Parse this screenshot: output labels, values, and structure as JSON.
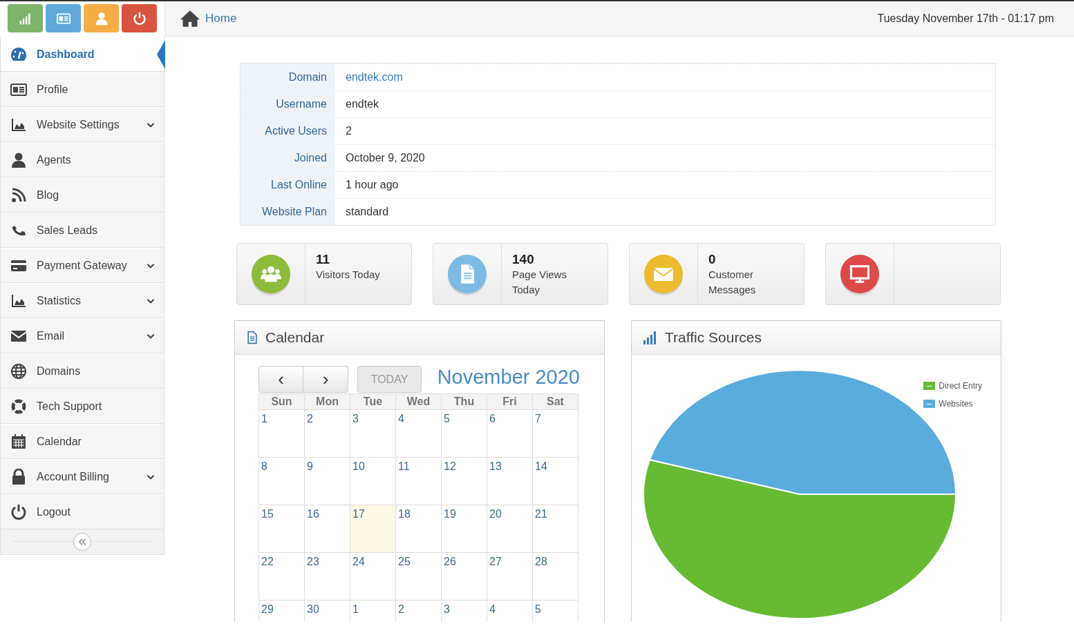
{
  "top_buttons": [
    {
      "color": "#7fb46b"
    },
    {
      "color": "#5fa9dd"
    },
    {
      "color": "#f8ac45"
    },
    {
      "color": "#d9543e"
    }
  ],
  "sidebar": {
    "items": [
      {
        "label": "Dashboard",
        "selected": true,
        "has_submenu": false
      },
      {
        "label": "Profile",
        "selected": false,
        "has_submenu": false
      },
      {
        "label": "Website Settings",
        "selected": false,
        "has_submenu": true
      },
      {
        "label": "Agents",
        "selected": false,
        "has_submenu": false
      },
      {
        "label": "Blog",
        "selected": false,
        "has_submenu": false
      },
      {
        "label": "Sales Leads",
        "selected": false,
        "has_submenu": false
      },
      {
        "label": "Payment Gateway",
        "selected": false,
        "has_submenu": true
      },
      {
        "label": "Statistics",
        "selected": false,
        "has_submenu": true
      },
      {
        "label": "Email",
        "selected": false,
        "has_submenu": true
      },
      {
        "label": "Domains",
        "selected": false,
        "has_submenu": false
      },
      {
        "label": "Tech Support",
        "selected": false,
        "has_submenu": false
      },
      {
        "label": "Calendar",
        "selected": false,
        "has_submenu": false
      },
      {
        "label": "Account Billing",
        "selected": false,
        "has_submenu": true
      },
      {
        "label": "Logout",
        "selected": false,
        "has_submenu": false
      }
    ]
  },
  "breadcrumb": {
    "label": "Home"
  },
  "datetime": "Tuesday November 17th - 01:17 pm",
  "account_info": [
    {
      "label": "Domain",
      "value": "endtek.com",
      "kind": "link"
    },
    {
      "label": "Username",
      "value": "endtek",
      "kind": "text"
    },
    {
      "label": "Active Users",
      "value": "2",
      "kind": "text"
    },
    {
      "label": "Joined",
      "value": "October 9, 2020",
      "kind": "text"
    },
    {
      "label": "Last Online",
      "value": "1 hour ago",
      "kind": "text"
    },
    {
      "label": "Website Plan",
      "value": "standard",
      "kind": "text"
    }
  ],
  "stats": [
    {
      "value": "11",
      "label": "Visitors Today",
      "color": "#8dbb3c"
    },
    {
      "value": "140",
      "label": "Page Views Today",
      "color": "#7dbbe6"
    },
    {
      "value": "0",
      "label": "Customer Messages",
      "color": "#ecbb2e"
    },
    {
      "color": "#dc4a48"
    }
  ],
  "calendar": {
    "title": "Calendar",
    "prev": "‹",
    "next": "›",
    "today_button": {
      "label": "TODAY",
      "disabled": true
    },
    "month": "November 2020",
    "weekdays": [
      "Sun",
      "Mon",
      "Tue",
      "Wed",
      "Thu",
      "Fri",
      "Sat"
    ],
    "weeks": [
      {
        "days": [
          {
            "day": "1",
            "today": false
          },
          {
            "day": "2",
            "today": false
          },
          {
            "day": "3",
            "today": false
          },
          {
            "day": "4",
            "today": false
          },
          {
            "day": "5",
            "today": false
          },
          {
            "day": "6",
            "today": false
          },
          {
            "day": "7",
            "today": false
          }
        ]
      },
      {
        "days": [
          {
            "day": "8",
            "today": false
          },
          {
            "day": "9",
            "today": false
          },
          {
            "day": "10",
            "today": false
          },
          {
            "day": "11",
            "today": false
          },
          {
            "day": "12",
            "today": false
          },
          {
            "day": "13",
            "today": false
          },
          {
            "day": "14",
            "today": false
          }
        ]
      },
      {
        "days": [
          {
            "day": "15",
            "today": false
          },
          {
            "day": "16",
            "today": false
          },
          {
            "day": "17",
            "today": true
          },
          {
            "day": "18",
            "today": false
          },
          {
            "day": "19",
            "today": false
          },
          {
            "day": "20",
            "today": false
          },
          {
            "day": "21",
            "today": false
          }
        ]
      },
      {
        "days": [
          {
            "day": "22",
            "today": false
          },
          {
            "day": "23",
            "today": false
          },
          {
            "day": "24",
            "today": false
          },
          {
            "day": "25",
            "today": false
          },
          {
            "day": "26",
            "today": false
          },
          {
            "day": "27",
            "today": false
          },
          {
            "day": "28",
            "today": false
          }
        ]
      },
      {
        "days": [
          {
            "day": "29",
            "today": false
          },
          {
            "day": "30",
            "today": false
          },
          {
            "day": "1",
            "today": false
          },
          {
            "day": "2",
            "today": false
          },
          {
            "day": "3",
            "today": false
          },
          {
            "day": "4",
            "today": false
          },
          {
            "day": "5",
            "today": false
          }
        ]
      }
    ]
  },
  "traffic": {
    "title": "Traffic Sources",
    "legend": [
      {
        "label": "Direct Entry",
        "color": "#66bb33"
      },
      {
        "label": "Websites",
        "color": "#5aacdc"
      }
    ]
  }
}
